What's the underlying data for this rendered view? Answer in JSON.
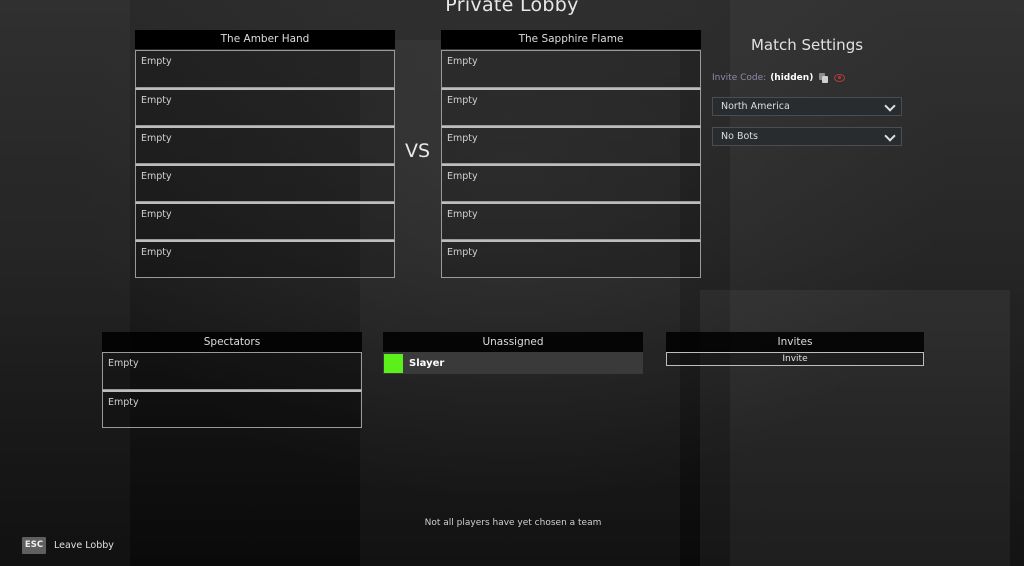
{
  "title": "Private Lobby",
  "teams": [
    {
      "name": "The Amber Hand",
      "slots": [
        "Empty",
        "Empty",
        "Empty",
        "Empty",
        "Empty",
        "Empty"
      ]
    },
    {
      "name": "The Sapphire Flame",
      "slots": [
        "Empty",
        "Empty",
        "Empty",
        "Empty",
        "Empty",
        "Empty"
      ]
    }
  ],
  "vs_label": "VS",
  "match_settings": {
    "title": "Match Settings",
    "invite_code_label": "Invite Code:",
    "invite_code_value": "(hidden)",
    "copy_icon": "copy-icon",
    "reveal_icon": "eye-icon",
    "region": "North America",
    "bots": "No Bots"
  },
  "spectators": {
    "title": "Spectators",
    "slots": [
      "Empty",
      "Empty"
    ]
  },
  "unassigned": {
    "title": "Unassigned",
    "players": [
      {
        "name": "Slayer",
        "color": "#5cf01a"
      }
    ]
  },
  "invites": {
    "title": "Invites",
    "button_label": "Invite"
  },
  "status_message": "Not all players have yet chosen a team",
  "footer": {
    "key_label": "ESC",
    "action_label": "Leave Lobby"
  }
}
